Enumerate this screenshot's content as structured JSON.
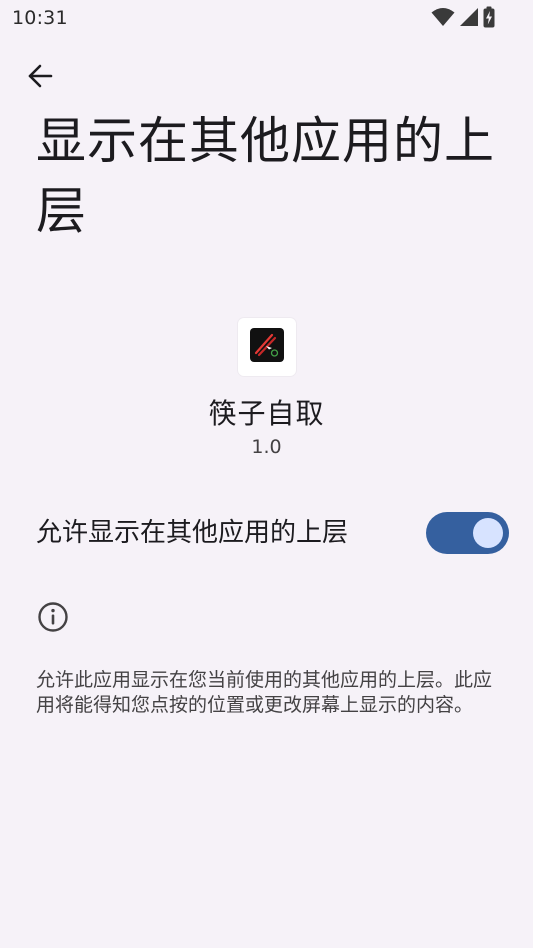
{
  "status_bar": {
    "time": "10:31",
    "icons": [
      "wifi-icon",
      "signal-icon",
      "battery-charging-icon"
    ]
  },
  "toolbar": {
    "back_icon": "arrow-back-icon"
  },
  "page": {
    "title": "显示在其他应用的上层"
  },
  "app": {
    "name": "筷子自取",
    "version": "1.0",
    "icon": "app-icon"
  },
  "permission": {
    "label": "允许显示在其他应用的上层",
    "enabled": true,
    "colors": {
      "track": "#35609f",
      "thumb": "#d7e3ff"
    }
  },
  "info": {
    "icon": "info-icon",
    "text": "允许此应用显示在您当前使用的其他应用的上层。此应用将能得知您点按的位置或更改屏幕上显示的内容。"
  },
  "colors": {
    "background": "#f6f2f8",
    "text_primary": "#1c1b1f",
    "text_secondary": "#444244"
  }
}
